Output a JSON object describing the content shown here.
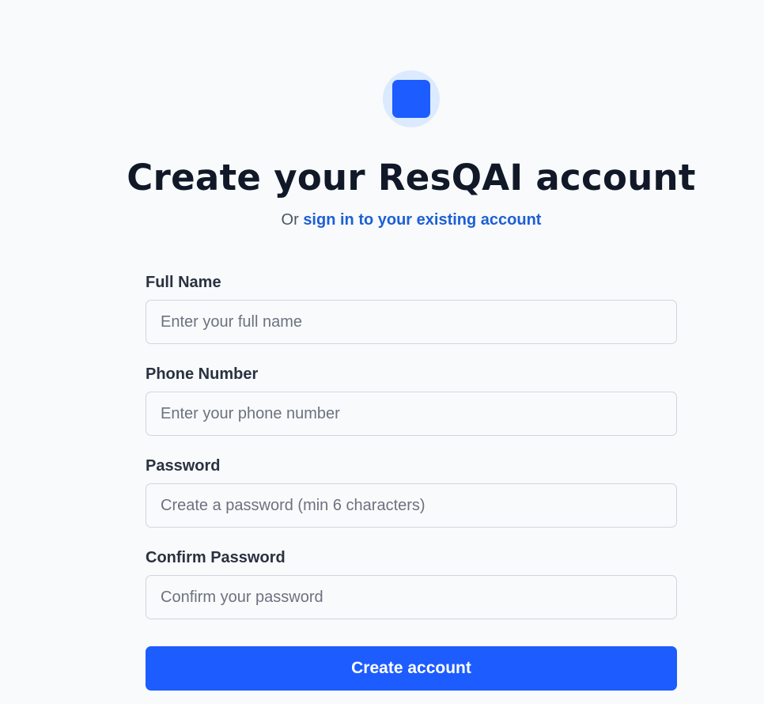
{
  "header": {
    "title": "Create your ResQAI account",
    "subtitle_prefix": "Or ",
    "signin_link": "sign in to your existing account"
  },
  "form": {
    "full_name": {
      "label": "Full Name",
      "placeholder": "Enter your full name",
      "value": ""
    },
    "phone": {
      "label": "Phone Number",
      "placeholder": "Enter your phone number",
      "value": ""
    },
    "password": {
      "label": "Password",
      "placeholder": "Create a password (min 6 characters)",
      "value": ""
    },
    "confirm_password": {
      "label": "Confirm Password",
      "placeholder": "Confirm your password",
      "value": ""
    },
    "submit_label": "Create account"
  },
  "colors": {
    "accent": "#1d5cff",
    "link": "#1d5fd6",
    "logo_bg": "#dbeafe"
  },
  "icons": {
    "logo": "app-logo-icon"
  }
}
